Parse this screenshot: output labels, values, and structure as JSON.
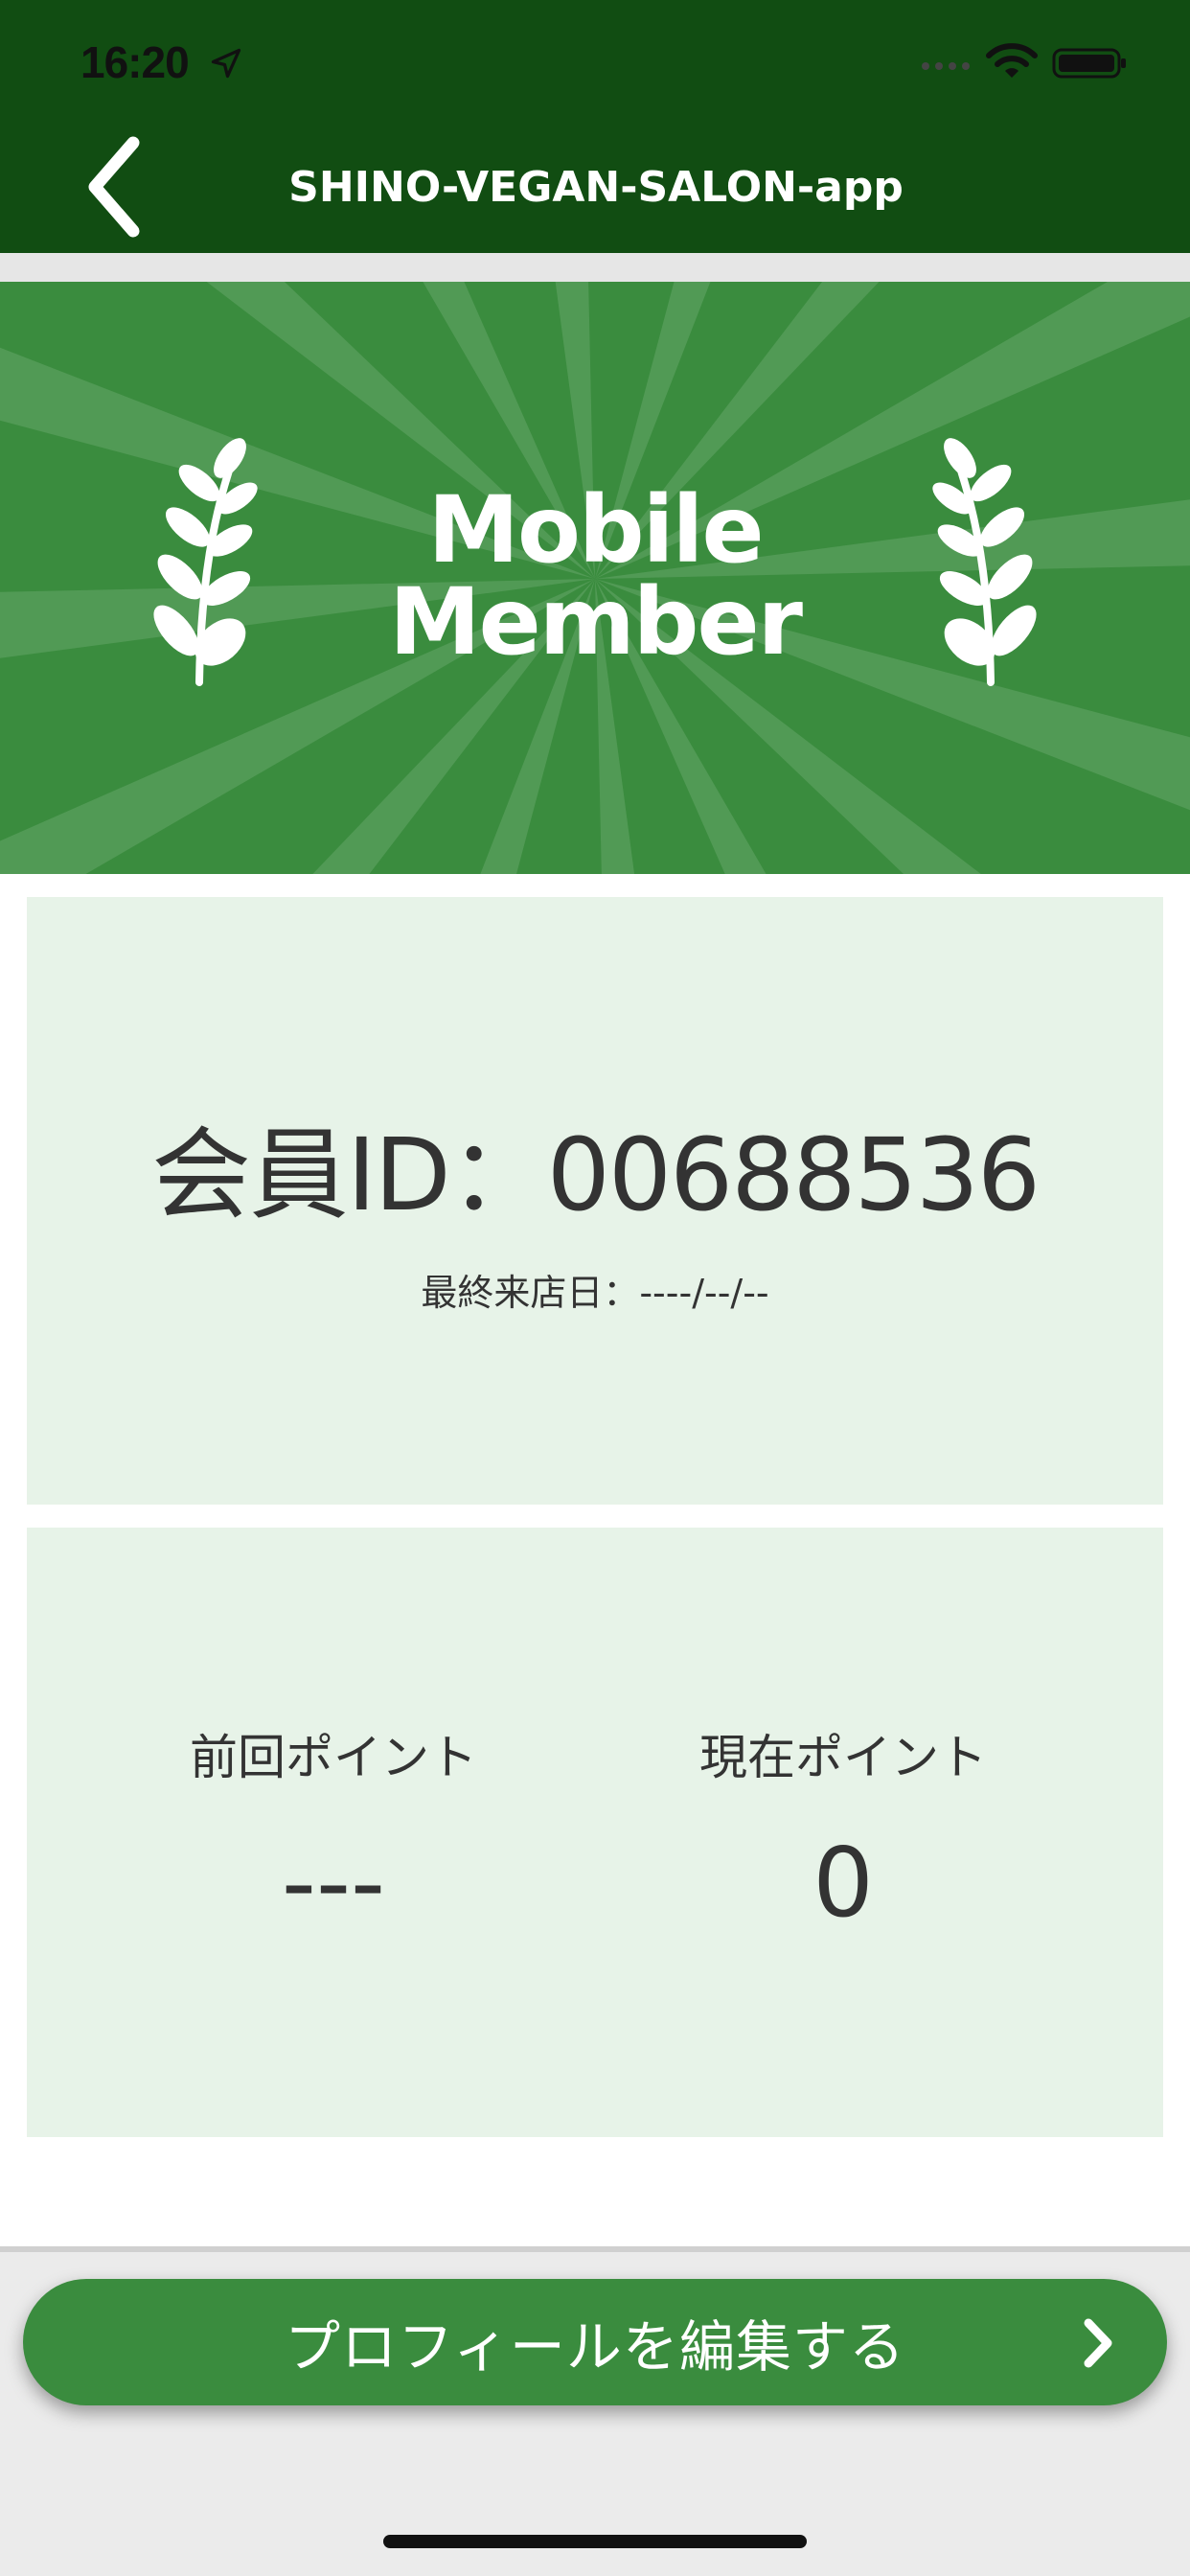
{
  "status_bar": {
    "time": "16:20",
    "icons": [
      "location-arrow-icon",
      "signal-icon",
      "wifi-icon",
      "battery-icon"
    ]
  },
  "nav": {
    "title": "SHINO-VEGAN-SALON-app",
    "back_icon": "chevron-left-icon"
  },
  "banner": {
    "line1": "Mobile",
    "line2": "Member",
    "decoration": "laurel-icon"
  },
  "member": {
    "id_text": "会員ID：00688536",
    "last_visit": "最終来店日：----/--/--"
  },
  "points": {
    "previous_label": "前回ポイント",
    "previous_value": "---",
    "current_label": "現在ポイント",
    "current_value": "0"
  },
  "actions": {
    "edit_profile": "プロフィールを編集する",
    "edit_icon": "chevron-right-icon"
  },
  "colors": {
    "nav_bg": "#114d12",
    "accent": "#3a8c3e",
    "card_bg": "#e7f3e8"
  }
}
